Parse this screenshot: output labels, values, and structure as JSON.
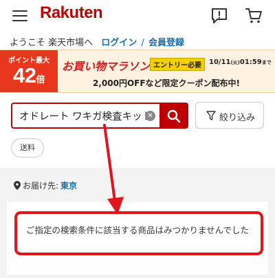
{
  "header": {
    "logo": "Rakuten",
    "menu_icon": "hamburger-menu-icon",
    "notice_icon": "exclamation-speech-icon",
    "cart_icon": "shopping-cart-icon"
  },
  "welcome": {
    "greeting": "ようこそ 楽天市場へ",
    "login_link": "ログイン",
    "separator": "/",
    "register_link": "会員登録"
  },
  "banner": {
    "points_label": "ポイント最大",
    "points_value": "42",
    "points_unit": "倍",
    "campaign": "お買い物マラソン",
    "entry_badge": "エントリー必要",
    "date_prefix": "10/11",
    "date_day": "(火)",
    "date_time": "01:59",
    "date_suffix": "まで",
    "coupon_text": "2,000円OFFなど限定クーポン配布中!"
  },
  "search": {
    "value": "オドレート ワキガ検査キット",
    "clear_icon": "clear-x-icon",
    "search_icon": "search-magnifier-icon"
  },
  "filter": {
    "label": "絞り込み",
    "icon": "funnel-filter-icon"
  },
  "chips": {
    "shipping": "送料"
  },
  "delivery": {
    "label": "お届け先:",
    "city": "東京",
    "icon": "location-pin-icon"
  },
  "result": {
    "message": "ご指定の検索条件に該当する商品はみつかりませんでした"
  },
  "colors": {
    "brand_red": "#bf0000",
    "link_blue": "#1a6ea8",
    "annotation_red": "#e4141d",
    "banner_orange": "#e8371c",
    "entry_yellow": "#f5d000"
  }
}
